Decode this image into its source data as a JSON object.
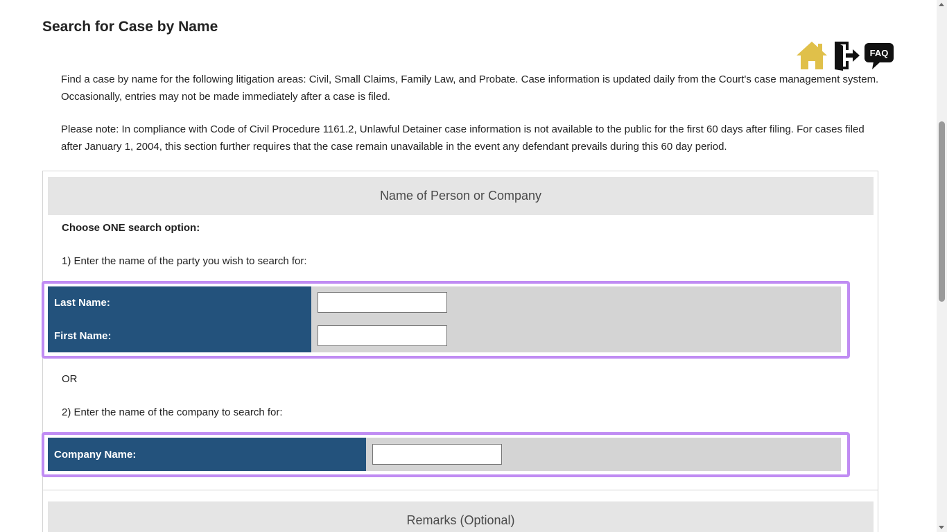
{
  "page": {
    "title": "Search for Case by Name"
  },
  "icons": {
    "home": "home-icon",
    "exit": "exit-door-icon",
    "faq": "faq-icon",
    "faq_label": "FAQ",
    "home_color": "#e0c04a",
    "dark_color": "#111111"
  },
  "intro": {
    "p1": "Find a case by name for the following litigation areas: Civil, Small Claims, Family Law, and Probate. Case information is updated daily from the Court's case management system. Occasionally, entries may not be made immediately after a case is filed.",
    "p2": "Please note: In compliance with Code of Civil Procedure 1161.2, Unlawful Detainer case information is not available to the public for the first 60 days after filing. For cases filed after January 1, 2004, this section further requires that the case remain unavailable in the event any defendant prevails during this 60 day period."
  },
  "name_section": {
    "header": "Name of Person or Company",
    "choose_label": "Choose ONE search option:",
    "option1_label": "1) Enter the name of the party you wish to search for:",
    "last_name_label": "Last Name:",
    "last_name_value": "",
    "first_name_label": "First Name:",
    "first_name_value": "",
    "or_label": "OR",
    "option2_label": "2) Enter the name of the company to search for:",
    "company_name_label": "Company Name:",
    "company_name_value": ""
  },
  "remarks_section": {
    "header": "Remarks (Optional)"
  },
  "colors": {
    "label_bg": "#23527c",
    "field_bg": "#d4d4d4",
    "section_bg": "#e5e5e5",
    "highlight": "#c08cf3"
  }
}
